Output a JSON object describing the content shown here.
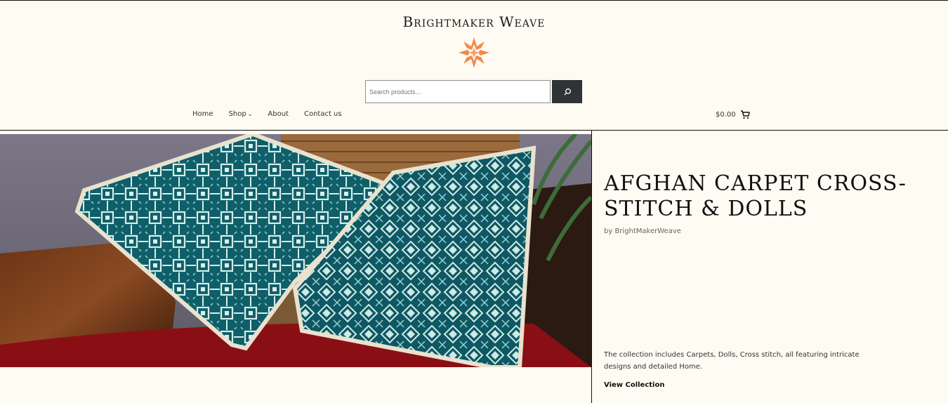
{
  "site": {
    "title": "Brightmaker Weave"
  },
  "search": {
    "placeholder": "Search products…"
  },
  "nav": {
    "items": [
      {
        "label": "Home"
      },
      {
        "label": "Shop"
      },
      {
        "label": "About"
      },
      {
        "label": "Contact us"
      }
    ]
  },
  "cart": {
    "total": "$0.00"
  },
  "product": {
    "title": "AFGHAN CARPET CROSS-STITCH & DOLLS",
    "byline": "by BrightMakerWeave",
    "description": "The collection includes Carpets, Dolls, Cross stitch, all featuring intricate designs and detailed Home.",
    "cta": "View Collection"
  },
  "colors": {
    "background": "#fefbf2",
    "accent": "#f08a4b",
    "button": "#2f3336",
    "pillow": "#0e5f6a"
  },
  "icons": {
    "logo": "eight-point-star-logo",
    "search": "search-icon",
    "cart": "cart-icon",
    "chevron": "chevron-down-icon"
  }
}
